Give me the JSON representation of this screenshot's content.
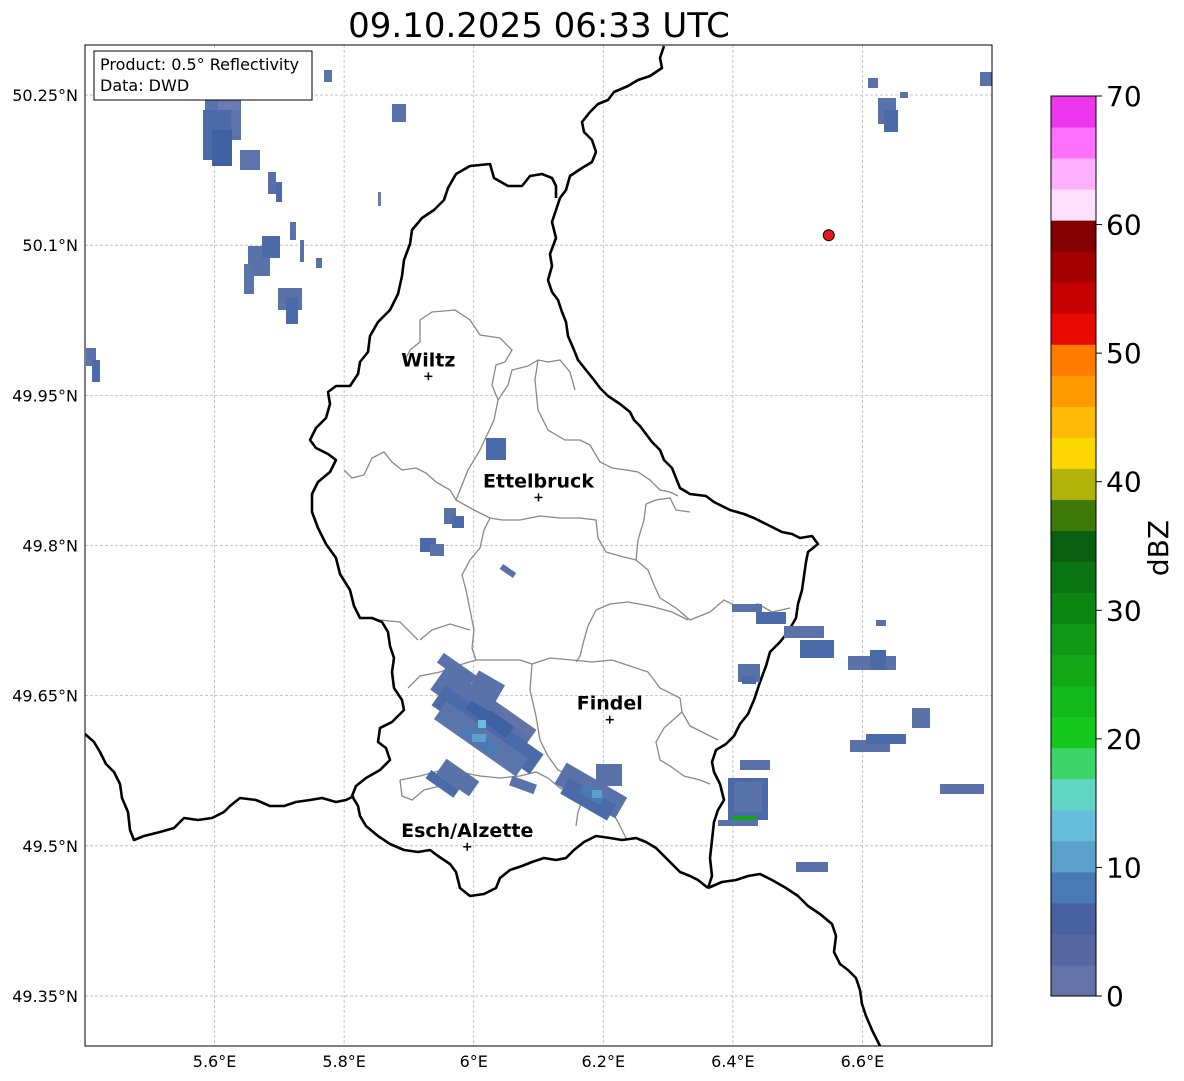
{
  "title": "09.10.2025 06:33 UTC",
  "info_box": {
    "product": "Product: 0.5° Reflectivity",
    "data_source": "Data: DWD"
  },
  "axes": {
    "lon_ticks": [
      "5.6°E",
      "5.8°E",
      "6°E",
      "6.2°E",
      "6.4°E",
      "6.6°E"
    ],
    "lat_ticks": [
      "50.25°N",
      "50.1°N",
      "49.95°N",
      "49.8°N",
      "49.65°N",
      "49.5°N",
      "49.35°N"
    ],
    "lon_values": [
      5.6,
      5.8,
      6.0,
      6.2,
      6.4,
      6.6
    ],
    "lat_values": [
      50.25,
      50.1,
      49.95,
      49.8,
      49.65,
      49.5,
      49.35
    ],
    "lon_range": [
      5.4,
      6.8
    ],
    "lat_range": [
      49.3,
      50.3
    ],
    "grid": true
  },
  "cities": [
    {
      "name": "Wiltz",
      "lon": 5.93,
      "lat": 49.969
    },
    {
      "name": "Ettelbruck",
      "lon": 6.1,
      "lat": 49.848
    },
    {
      "name": "Findel",
      "lon": 6.21,
      "lat": 49.626
    },
    {
      "name": "Esch/Alzette",
      "lon": 5.99,
      "lat": 49.499
    }
  ],
  "radar_site": {
    "lon": 6.548,
    "lat": 50.11,
    "color": "#e41a1c"
  },
  "colorbar": {
    "label": "dBZ",
    "tick_labels": [
      "0",
      "10",
      "20",
      "30",
      "40",
      "50",
      "60",
      "70"
    ],
    "range": [
      0,
      70
    ],
    "colors": [
      "#6373a8",
      "#5566a0",
      "#4660a0",
      "#4a7ab6",
      "#5b9fcc",
      "#66bedc",
      "#61d6c4",
      "#3dd46a",
      "#14c81e",
      "#12b91a",
      "#12a818",
      "#0f9815",
      "#0c8613",
      "#0a7412",
      "#095e0f",
      "#3d7a0a",
      "#b2b308",
      "#ffd700",
      "#ffba08",
      "#ff9a00",
      "#ff7c00",
      "#e80a00",
      "#c60000",
      "#a40000",
      "#820000",
      "#ffe0ff",
      "#ffb0ff",
      "#ff70ff",
      "#ec35ec"
    ]
  }
}
